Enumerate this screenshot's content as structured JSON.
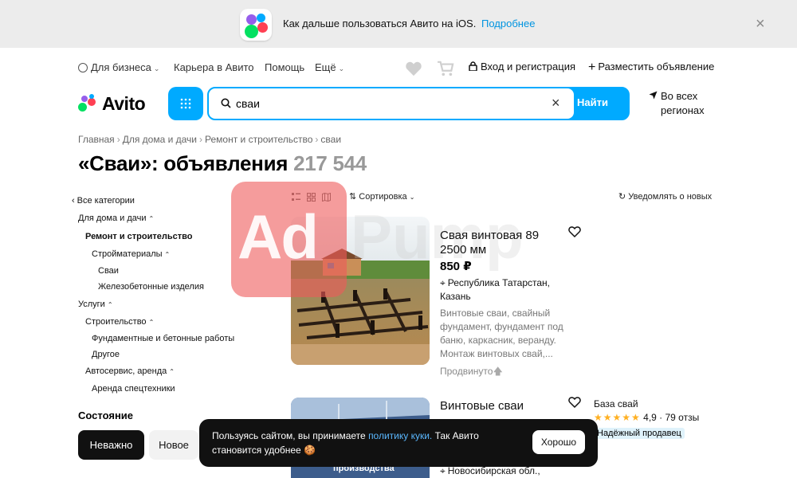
{
  "banner": {
    "text": "Как дальше пользоваться Авито на iOS.",
    "link": "Подробнее",
    "close": "×"
  },
  "topnav": {
    "business": "Для бизнеса",
    "career": "Карьера в Авито",
    "help": "Помощь",
    "more": "Ещё",
    "login": "Вход и регистрация",
    "post": "Разместить объявление"
  },
  "logo": {
    "text": "Avito"
  },
  "search": {
    "value": "сваи",
    "submit": "Найти",
    "clear": "×"
  },
  "region": {
    "line1": "Во всех",
    "line2": "регионах"
  },
  "breadcrumb": [
    "Главная",
    "Для дома и дачи",
    "Ремонт и строительство",
    "сваи"
  ],
  "heading": {
    "title": "«Сваи»: объявления",
    "count": "217 544"
  },
  "sidebar": {
    "all": "Все категории",
    "home": "Для дома и дачи",
    "repair": "Ремонт и строительство",
    "materials": "Стройматериалы",
    "piles": "Сваи",
    "concrete": "Железобетонные изделия",
    "services": "Услуги",
    "construction": "Строительство",
    "foundation": "Фундаментные и бетонные работы",
    "other": "Другое",
    "autoservice": "Автосервис, аренда",
    "rent": "Аренда спецтехники"
  },
  "state": {
    "title": "Состояние",
    "any": "Неважно",
    "new": "Новое"
  },
  "toolbar": {
    "sort": "Сортировка",
    "notify": "Уведомлять о новых"
  },
  "watermark": {
    "text1": "Ad",
    "text2": "Pump"
  },
  "listing1": {
    "title_line1": "Свая винтовая 89",
    "title_line2": "2500 мм",
    "price": "850 ₽",
    "loc_line1": "Республика Татарстан,",
    "loc_line2": "Казань",
    "desc": "Винтовые сваи, свайный фундамент, фундамент под баню, каркасник, веранду. Монтаж винтовых свай,...",
    "promo": "Продвинуто"
  },
  "listing2": {
    "title": "Винтовые сваи",
    "loc": "Новосибирская обл.,",
    "photo_caption": "производства"
  },
  "seller": {
    "name": "База свай",
    "stars": "★★★★★",
    "rating": "4,9",
    "reviews": "79 отзы",
    "badge": "Надёжный продавец"
  },
  "cookie": {
    "text_before": "Пользуясь сайтом, вы принимаете",
    "link": "политику куки.",
    "text_after": "Так Авито становится удобнее 🍪",
    "button": "Хорошо"
  },
  "colors": {
    "accent": "#00aaff",
    "link": "#0094e0",
    "dark": "#111111"
  }
}
